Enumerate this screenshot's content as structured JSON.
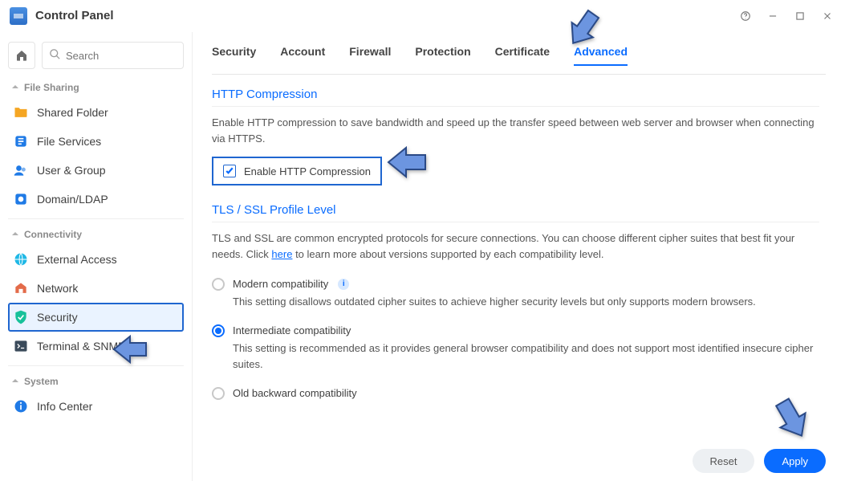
{
  "window": {
    "title": "Control Panel"
  },
  "sidebar": {
    "search_placeholder": "Search",
    "sections": [
      {
        "label": "File Sharing",
        "items": [
          {
            "label": "Shared Folder"
          },
          {
            "label": "File Services"
          },
          {
            "label": "User & Group"
          },
          {
            "label": "Domain/LDAP"
          }
        ]
      },
      {
        "label": "Connectivity",
        "items": [
          {
            "label": "External Access"
          },
          {
            "label": "Network"
          },
          {
            "label": "Security"
          },
          {
            "label": "Terminal & SNMP"
          }
        ]
      },
      {
        "label": "System",
        "items": [
          {
            "label": "Info Center"
          }
        ]
      }
    ]
  },
  "tabs": [
    "Security",
    "Account",
    "Firewall",
    "Protection",
    "Certificate",
    "Advanced"
  ],
  "http": {
    "title": "HTTP Compression",
    "desc": "Enable HTTP compression to save bandwidth and speed up the transfer speed between web server and browser when connecting via HTTPS.",
    "checkbox_label": "Enable HTTP Compression"
  },
  "tls": {
    "title": "TLS / SSL Profile Level",
    "desc_pre": "TLS and SSL are common encrypted protocols for secure connections. You can choose different cipher suites that best fit your needs. Click ",
    "link": "here",
    "desc_post": " to learn more about versions supported by each compatibility level.",
    "options": [
      {
        "label": "Modern compatibility",
        "info": true,
        "desc": "This setting disallows outdated cipher suites to achieve higher security levels but only supports modern browsers."
      },
      {
        "label": "Intermediate compatibility",
        "desc": "This setting is recommended as it provides general browser compatibility and does not support most identified insecure cipher suites."
      },
      {
        "label": "Old backward compatibility"
      }
    ]
  },
  "footer": {
    "reset": "Reset",
    "apply": "Apply"
  }
}
